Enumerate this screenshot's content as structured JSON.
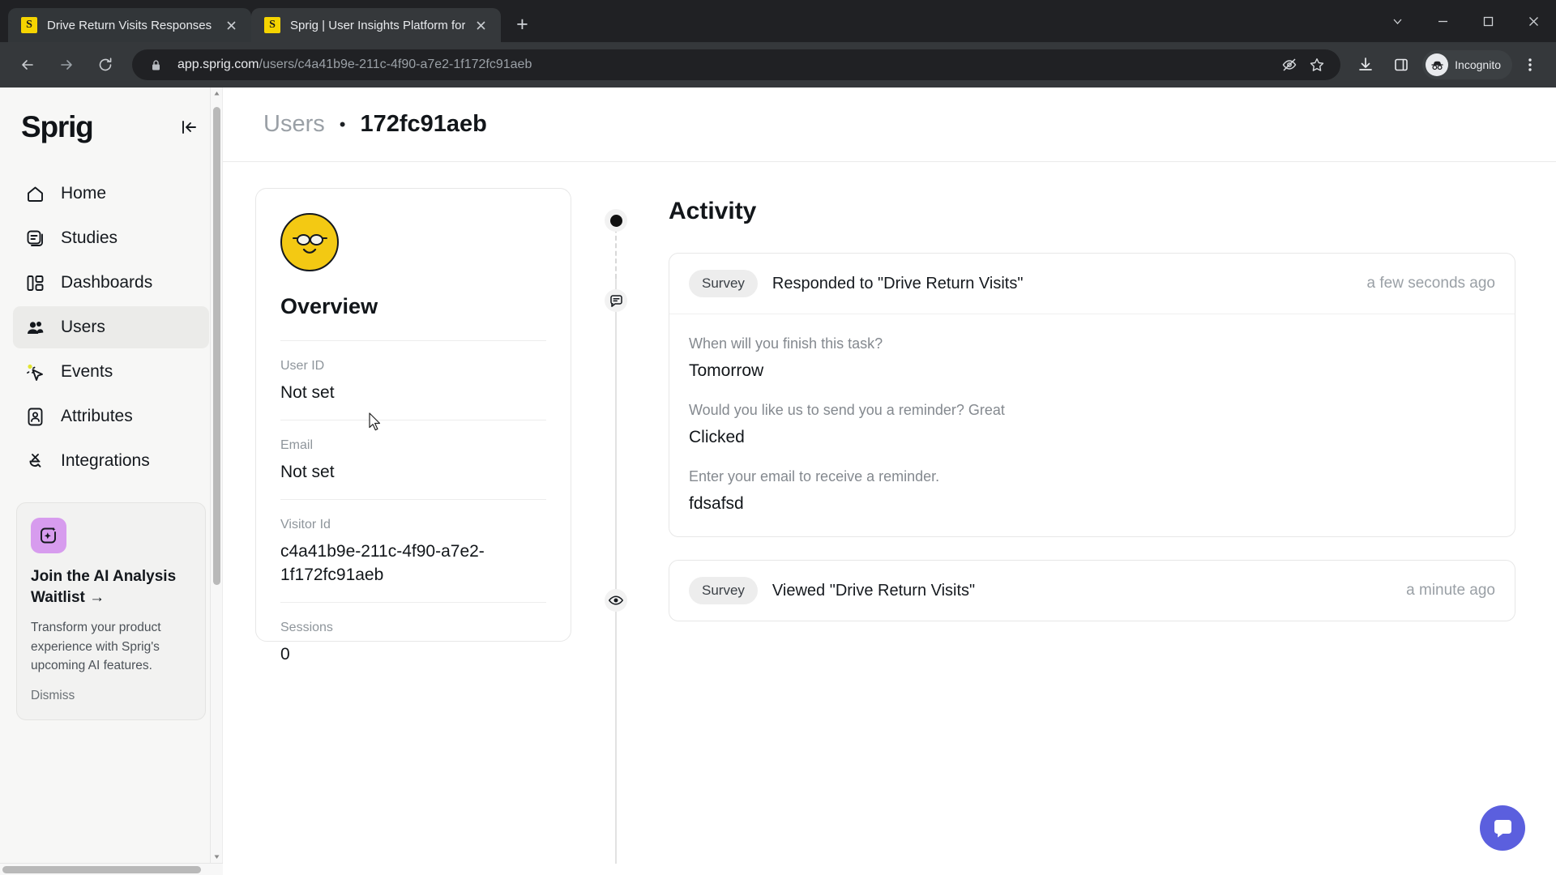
{
  "browser": {
    "tabs": [
      {
        "favicon_letter": "S",
        "title": "Drive Return Visits Responses",
        "active": false
      },
      {
        "favicon_letter": "S",
        "title": "Sprig | User Insights Platform for",
        "active": true
      }
    ],
    "new_tab_label": "+",
    "url_host": "app.sprig.com",
    "url_path": "/users/c4a41b9e-211c-4f90-a7e2-1f172fc91aeb",
    "profile_label": "Incognito"
  },
  "sidebar": {
    "logo": "Sprig",
    "items": [
      {
        "label": "Home",
        "icon": "home-icon",
        "active": false
      },
      {
        "label": "Studies",
        "icon": "studies-icon",
        "active": false
      },
      {
        "label": "Dashboards",
        "icon": "dashboards-icon",
        "active": false
      },
      {
        "label": "Users",
        "icon": "users-icon",
        "active": true
      },
      {
        "label": "Events",
        "icon": "events-icon",
        "active": false
      },
      {
        "label": "Attributes",
        "icon": "attributes-icon",
        "active": false
      },
      {
        "label": "Integrations",
        "icon": "integrations-icon",
        "active": false
      }
    ],
    "promo": {
      "title": "Join the AI Analysis Waitlist →",
      "body": "Transform your product experience with Sprig's upcoming AI features.",
      "dismiss": "Dismiss"
    }
  },
  "header": {
    "breadcrumb_parent": "Users",
    "breadcrumb_separator": "•",
    "breadcrumb_current": "172fc91aeb"
  },
  "overview": {
    "title": "Overview",
    "avatar_icon": "smiley-glasses-avatar",
    "fields": [
      {
        "label": "User ID",
        "value": "Not set"
      },
      {
        "label": "Email",
        "value": "Not set"
      },
      {
        "label": "Visitor Id",
        "value": "c4a41b9e-211c-4f90-a7e2-1f172fc91aeb"
      },
      {
        "label": "Sessions",
        "value": "0"
      }
    ]
  },
  "activity": {
    "title": "Activity",
    "entries": [
      {
        "icon": "survey-response-icon",
        "badge": "Survey",
        "text": "Responded to \"Drive Return Visits\"",
        "time": "a few seconds ago",
        "responses": [
          {
            "question": "When will you finish this task?",
            "answer": "Tomorrow"
          },
          {
            "question": "Would you like us to send you a reminder? Great",
            "answer": "Clicked"
          },
          {
            "question": "Enter your email to receive a reminder.",
            "answer": "fdsafsd"
          }
        ]
      },
      {
        "icon": "eye-icon",
        "badge": "Survey",
        "text": "Viewed \"Drive Return Visits\"",
        "time": "a minute ago",
        "responses": []
      }
    ]
  },
  "widgets": {
    "intercom_icon": "chat-bubble-icon"
  },
  "colors": {
    "brand_yellow": "#F3C913",
    "accent_purple": "#D79CEE",
    "intercom_blue": "#5B5FDE",
    "sidebar_bg": "#F7F7F6"
  }
}
